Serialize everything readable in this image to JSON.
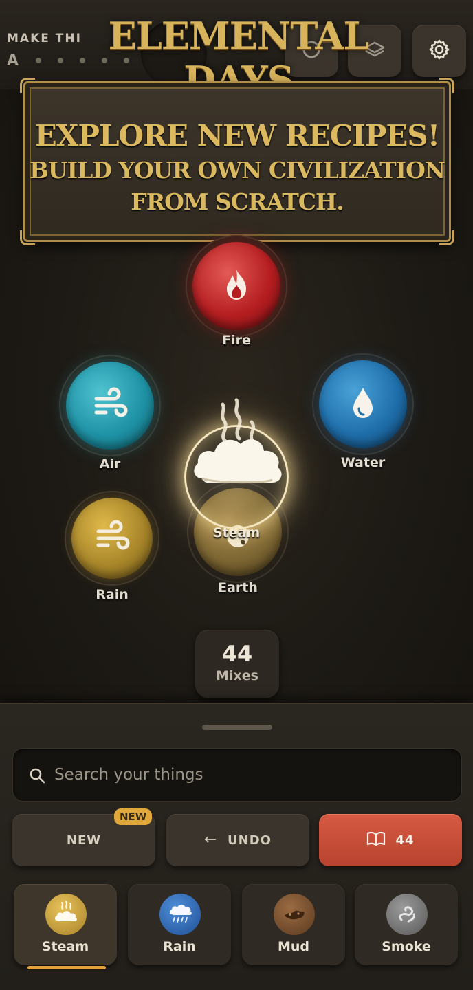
{
  "header": {
    "game_title": "ELEMENTAL DAYS",
    "partial_heading": "MAKE THI",
    "partial_letter": "A",
    "buttons": [
      {
        "icon": "circle-icon"
      },
      {
        "icon": "layers-icon"
      },
      {
        "icon": "gear-icon"
      }
    ]
  },
  "banner": {
    "headline": "EXPLORE NEW RECIPES!",
    "subline_1": "BUILD YOUR OWN CIVILIZATION",
    "subline_2": "FROM SCRATCH."
  },
  "board": {
    "elements": [
      {
        "label": "Fire",
        "icon": "flame-icon",
        "color": "#b51e21"
      },
      {
        "label": "Air",
        "icon": "wind-icon",
        "color": "#1f93a6"
      },
      {
        "label": "Water",
        "icon": "droplet-icon",
        "color": "#1f6fab"
      },
      {
        "label": "Rain",
        "icon": "wind-icon",
        "color": "#a8862a"
      },
      {
        "label": "Earth",
        "icon": "globe-icon",
        "color": "#7a6431"
      }
    ],
    "dragging": {
      "label": "Steam",
      "icon": "cloud-steam-icon",
      "glow_color": "#f5e6bf"
    },
    "mix_count": "44",
    "mix_label": "Mixes"
  },
  "sheet": {
    "search": {
      "placeholder": "Search your things",
      "value": ""
    },
    "actions": {
      "new_label": "NEW",
      "new_badge": "NEW",
      "undo_label": "UNDO",
      "book_count": "44",
      "book_color": "#c84c36"
    },
    "inventory": [
      {
        "label": "Steam",
        "icon": "cloud-steam-icon",
        "active": true
      },
      {
        "label": "Rain",
        "icon": "rain-cloud-icon",
        "active": false
      },
      {
        "label": "Mud",
        "icon": "mud-icon",
        "active": false
      },
      {
        "label": "Smoke",
        "icon": "smoke-icon",
        "active": false
      }
    ],
    "accent_color": "#e3a23a"
  }
}
